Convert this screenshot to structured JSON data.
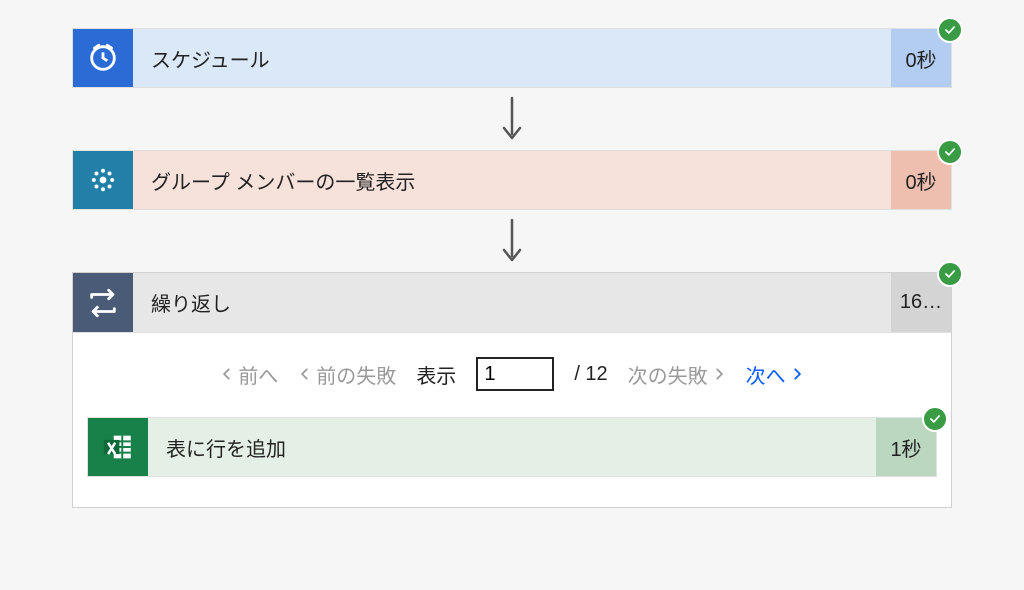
{
  "steps": {
    "schedule": {
      "label": "スケジュール",
      "time": "0秒"
    },
    "members": {
      "label": "グループ メンバーの一覧表示",
      "time": "0秒"
    },
    "loop": {
      "label": "繰り返し",
      "time": "16…"
    },
    "excel": {
      "label": "表に行を追加",
      "time": "1秒"
    }
  },
  "pager": {
    "prev": "前へ",
    "prev_fail": "前の失敗",
    "show": "表示",
    "value": "1",
    "total": "/ 12",
    "next_fail": "次の失敗",
    "next": "次へ"
  },
  "colors": {
    "success": "#399b44",
    "link": "#0a5cff"
  }
}
